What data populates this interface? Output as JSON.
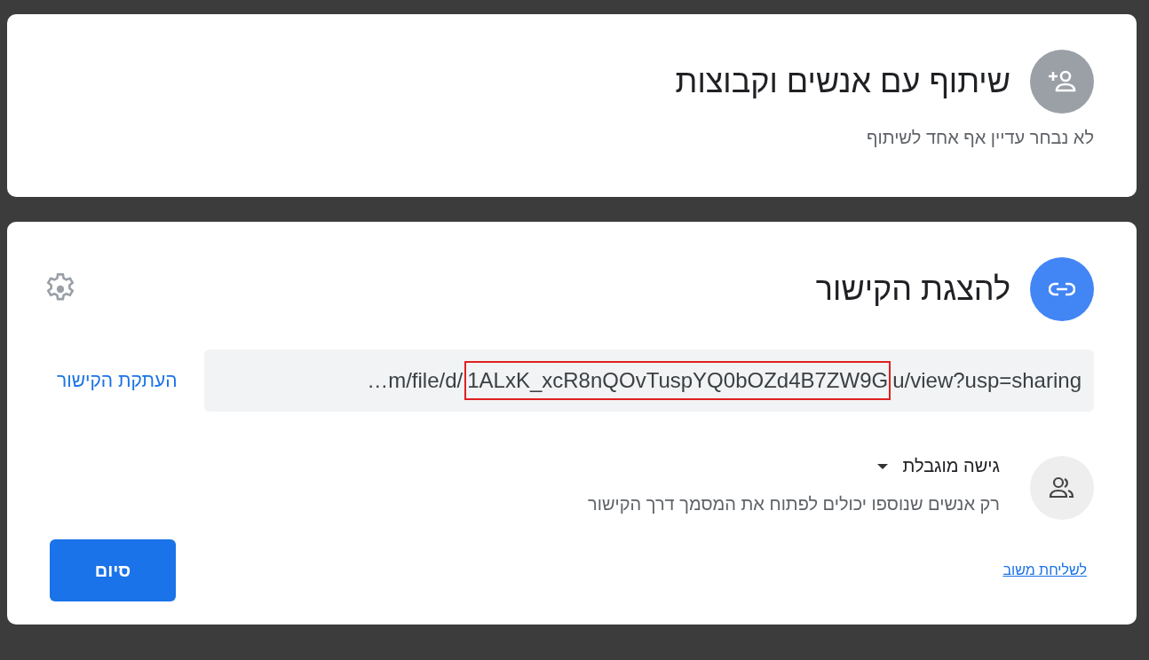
{
  "share_people": {
    "title": "שיתוף עם אנשים וקבוצות",
    "subtitle": "לא נבחר עדיין אף אחד לשיתוף"
  },
  "link_section": {
    "title": "להצגת הקישור",
    "url": {
      "before_highlight": "…m/file/d/",
      "highlighted": "1ALxK_xcR8nQOvTuspYQ0bOZd4B7ZW9G",
      "after_highlight": "u/view?usp=sharing"
    },
    "copy_label": "העתקת הקישור"
  },
  "access": {
    "label": "גישה מוגבלת",
    "description": "רק אנשים שנוספו יכולים לפתוח את המסמך דרך הקישור"
  },
  "feedback_link": "לשליחת משוב",
  "done_button": "סיום"
}
